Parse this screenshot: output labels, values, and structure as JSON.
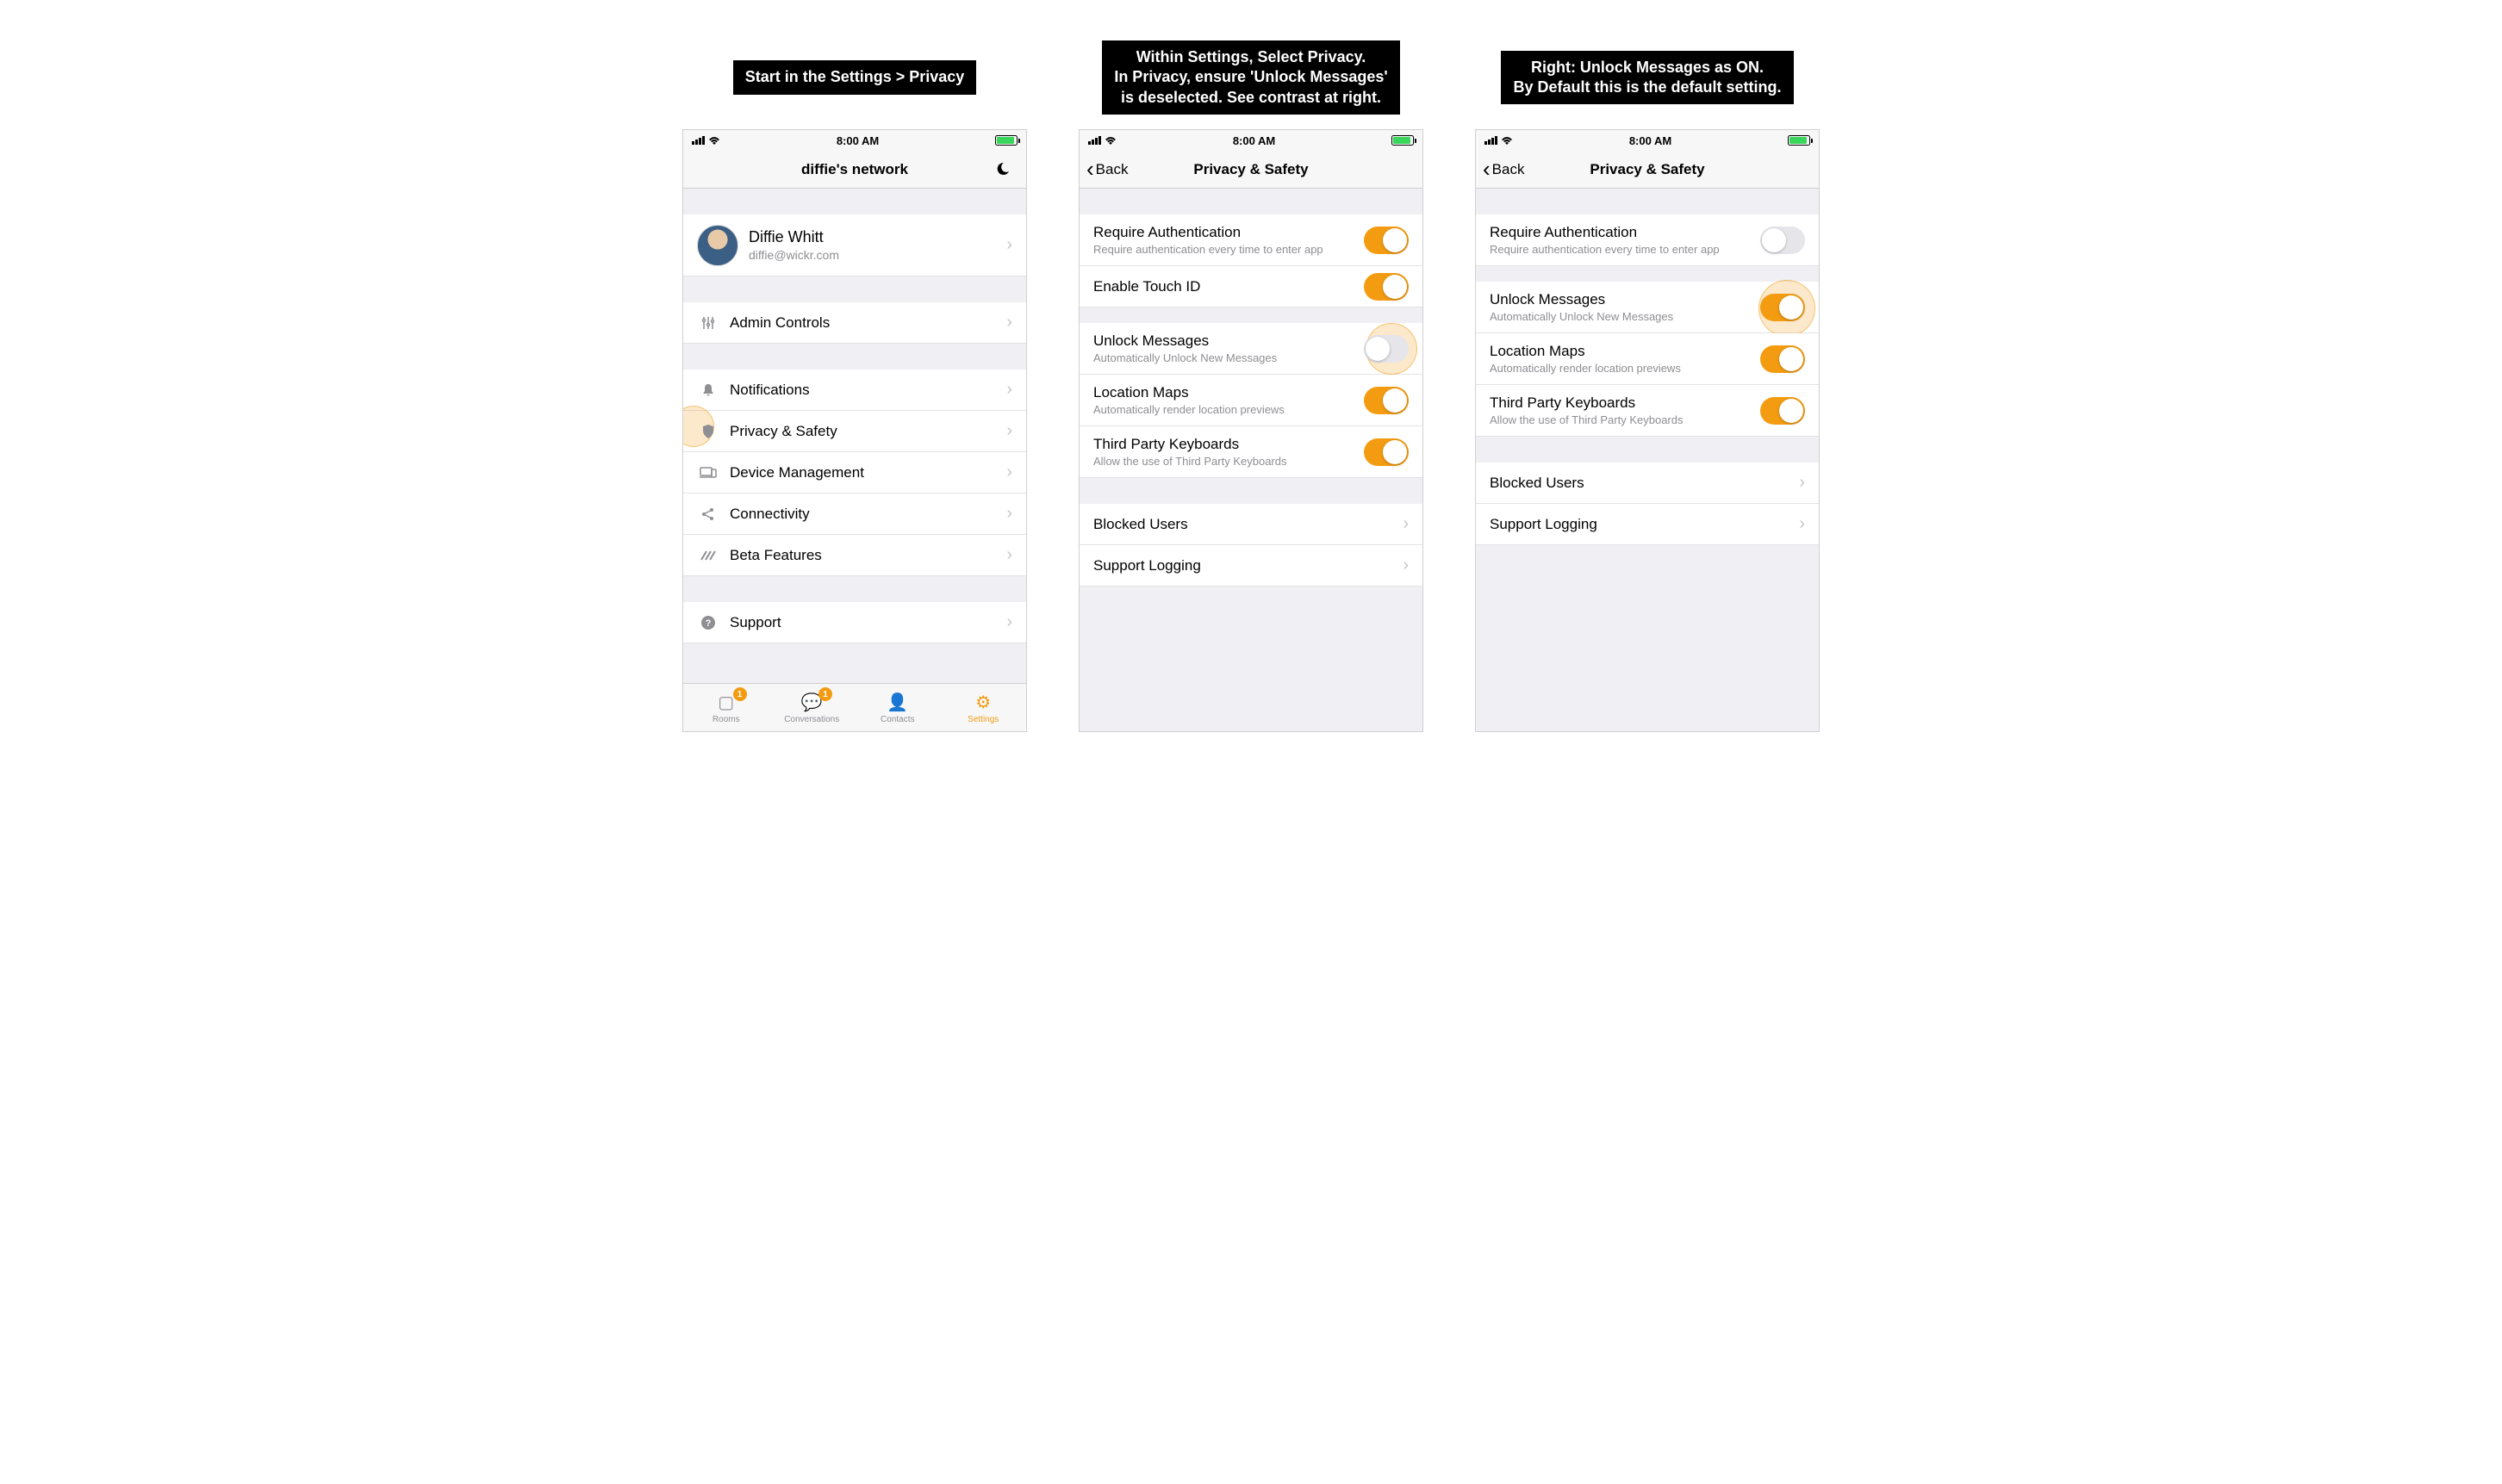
{
  "captions": {
    "c1": "Start in the Settings > Privacy",
    "c2": "Within Settings, Select Privacy.\nIn Privacy, ensure 'Unlock Messages'\nis deselected. See contrast at right.",
    "c3": "Right: Unlock Messages as ON.\nBy Default this is the default setting."
  },
  "status": {
    "time": "8:00 AM"
  },
  "screen1": {
    "title": "diffie's network",
    "profile": {
      "name": "Diffie Whitt",
      "email": "diffie@wickr.com"
    },
    "items": {
      "admin": "Admin Controls",
      "notifications": "Notifications",
      "privacy": "Privacy & Safety",
      "device": "Device Management",
      "connectivity": "Connectivity",
      "beta": "Beta Features",
      "support": "Support"
    },
    "tabs": {
      "rooms": "Rooms",
      "conversations": "Conversations",
      "contacts": "Contacts",
      "settings": "Settings",
      "badge": "1"
    }
  },
  "screen2": {
    "back": "Back",
    "title": "Privacy & Safety",
    "auth": {
      "title": "Require Authentication",
      "sub": "Require authentication every time to enter app"
    },
    "touchid": {
      "title": "Enable Touch ID"
    },
    "unlock": {
      "title": "Unlock Messages",
      "sub": "Automatically Unlock New Messages"
    },
    "location": {
      "title": "Location Maps",
      "sub": "Automatically render location previews"
    },
    "keyboards": {
      "title": "Third Party Keyboards",
      "sub": "Allow the use of Third Party Keyboards"
    },
    "blocked": "Blocked Users",
    "logging": "Support Logging"
  },
  "screen3": {
    "back": "Back",
    "title": "Privacy & Safety",
    "auth": {
      "title": "Require Authentication",
      "sub": "Require authentication every time to enter app"
    },
    "unlock": {
      "title": "Unlock Messages",
      "sub": "Automatically Unlock New Messages"
    },
    "location": {
      "title": "Location Maps",
      "sub": "Automatically render location previews"
    },
    "keyboards": {
      "title": "Third Party Keyboards",
      "sub": "Allow the use of Third Party Keyboards"
    },
    "blocked": "Blocked Users",
    "logging": "Support Logging"
  }
}
